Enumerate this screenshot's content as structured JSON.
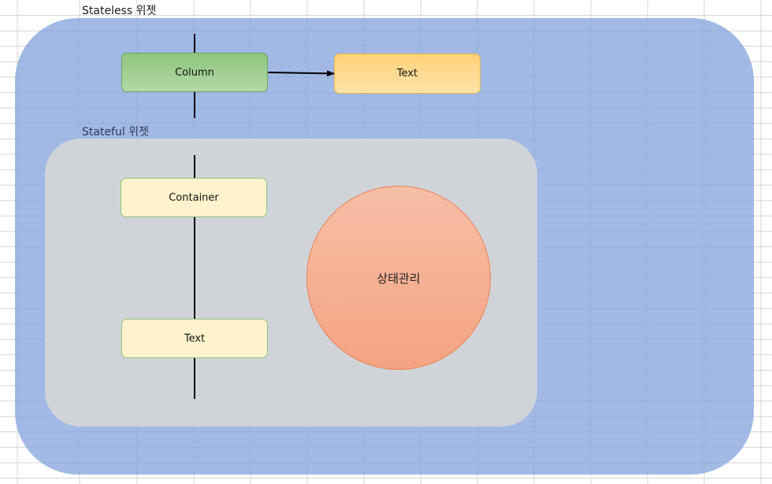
{
  "diagram": {
    "stateless_label": "Stateless 위젯",
    "stateful_label": "Stateful 위젯",
    "nodes": {
      "column": "Column",
      "text_top": "Text",
      "container": "Container",
      "text_bottom": "Text",
      "state": "상태관리"
    }
  },
  "colors": {
    "stateless_region": "#87a5dc",
    "stateful_region": "#d4d6d8",
    "column_fill": "#a9d18e",
    "text_top_fill": "#ffd966",
    "leaf_fill": "#fff2cc",
    "state_fill": "#f4b183",
    "gridline": "#d4d4d4"
  }
}
